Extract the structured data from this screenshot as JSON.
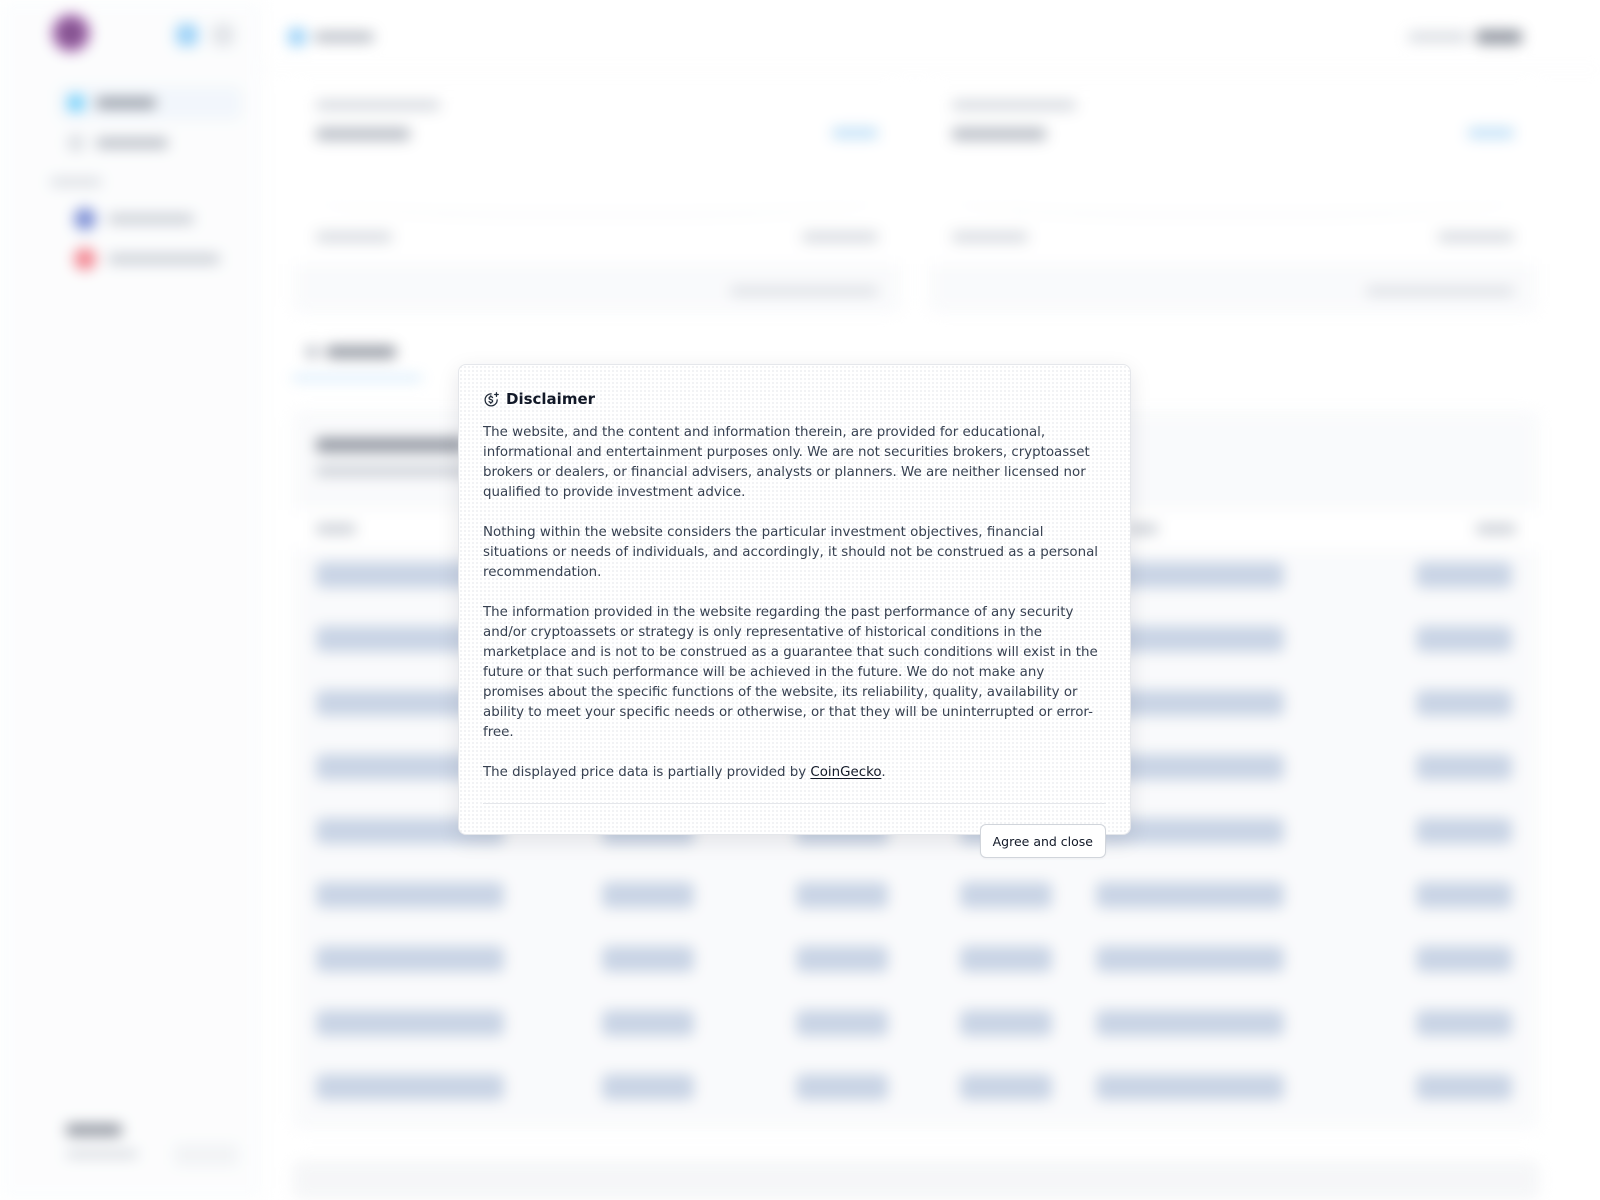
{
  "modal": {
    "title": "Disclaimer",
    "icon": "coin-sparkle-icon",
    "paragraphs": [
      "The website, and the content and information therein, are provided for educational, informational and entertainment purposes only. We are not securities brokers, cryptoasset brokers or dealers, or financial advisers, analysts or planners. We are neither licensed nor qualified to provide investment advice.",
      "Nothing within the website considers the particular investment objectives, financial situations or needs of individuals, and accordingly, it should not be construed as a personal recommendation.",
      "The information provided in the website regarding the past performance of any security and/or cryptoassets or strategy is only representative of historical conditions in the marketplace and is not to be construed as a guarantee that such conditions will exist in the future or that such performance will be achieved in the future. We do not make any promises about the specific functions of the website, its reliability, quality, availability or ability to meet your specific needs or otherwise, or that they will be uninterrupted or error-free."
    ],
    "price_note_prefix": "The displayed price data is partially provided by ",
    "price_note_link": "CoinGecko",
    "price_note_suffix": ".",
    "agree_label": "Agree and close"
  },
  "colors": {
    "accent": "#38bdf8",
    "link": "#111827",
    "placeholder_row": "#b7c6dd"
  }
}
